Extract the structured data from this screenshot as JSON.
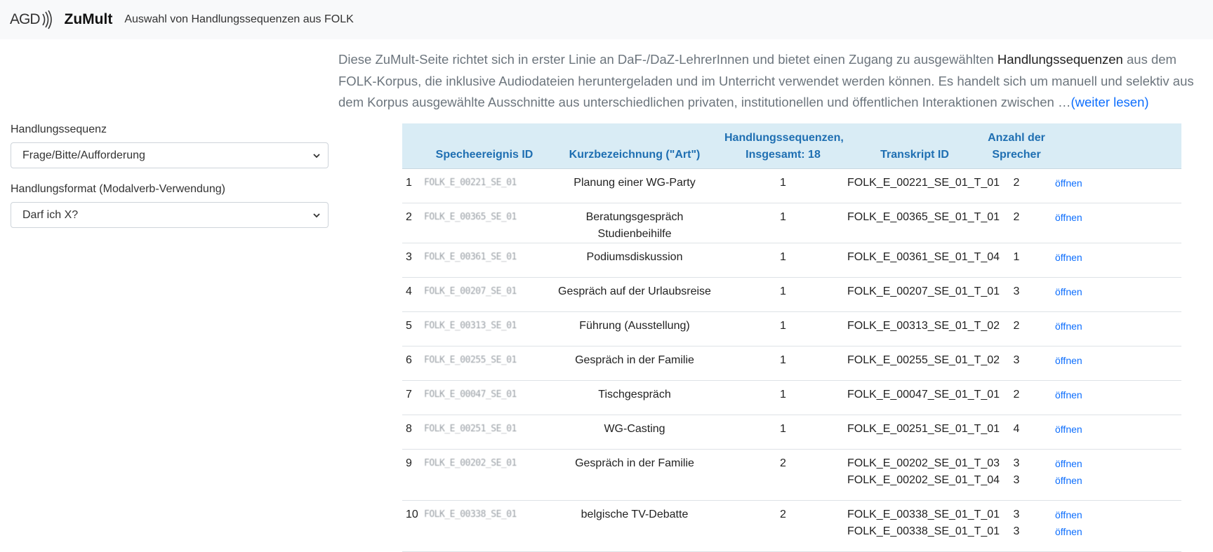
{
  "navbar": {
    "logo_text": "AGD",
    "brand": "ZuMult",
    "subtitle": "Auswahl von Handlungssequenzen aus FOLK"
  },
  "intro": {
    "part1": "Diese ZuMult-Seite richtet sich in erster Linie an DaF-/DaZ-LehrerInnen und bietet einen Zugang zu ausgewählten ",
    "highlight": "Handlungssequenzen",
    "part2": " aus dem FOLK-Korpus, die inklusive Audiodateien heruntergeladen und im Unterricht verwendet werden können. Es handelt sich um manuell und selektiv aus dem Korpus ausgewählte Ausschnitte aus unterschiedlichen privaten, institutionellen und öffentlichen Interaktionen zwischen …",
    "more_link": "(weiter lesen)"
  },
  "filters": {
    "sequence_label": "Handlungssequenz",
    "sequence_value": "Frage/Bitte/Aufforderung",
    "format_label": "Handlungsformat (Modalverb-Verwendung)",
    "format_value": "Darf ich X?"
  },
  "table": {
    "headers": {
      "event_id": "Specheereignis ID",
      "name": "Kurzbezeichnung (\"Art\")",
      "sequences_line1": "Handlungssequenzen,",
      "sequences_line2": "Insgesamt: 18",
      "transcript_id": "Transkript ID",
      "speakers_line1": "Anzahl der",
      "speakers_line2": "Sprecher"
    },
    "open_label": "öffnen",
    "rows": [
      {
        "num": "1",
        "event": "FOLK_E_00221_SE_01",
        "name": "Planung einer WG-Party",
        "count": "1",
        "t1": "FOLK_E_00221_SE_01_T_01",
        "s1": "2"
      },
      {
        "num": "2",
        "event": "FOLK_E_00365_SE_01",
        "name": "Beratungsgespräch Studienbeihilfe",
        "count": "1",
        "t1": "FOLK_E_00365_SE_01_T_01",
        "s1": "2"
      },
      {
        "num": "3",
        "event": "FOLK_E_00361_SE_01",
        "name": "Podiumsdiskussion",
        "count": "1",
        "t1": "FOLK_E_00361_SE_01_T_04",
        "s1": "1"
      },
      {
        "num": "4",
        "event": "FOLK_E_00207_SE_01",
        "name": "Gespräch auf der Urlaubsreise",
        "count": "1",
        "t1": "FOLK_E_00207_SE_01_T_01",
        "s1": "3"
      },
      {
        "num": "5",
        "event": "FOLK_E_00313_SE_01",
        "name": "Führung (Ausstellung)",
        "count": "1",
        "t1": "FOLK_E_00313_SE_01_T_02",
        "s1": "2"
      },
      {
        "num": "6",
        "event": "FOLK_E_00255_SE_01",
        "name": "Gespräch in der Familie",
        "count": "1",
        "t1": "FOLK_E_00255_SE_01_T_02",
        "s1": "3"
      },
      {
        "num": "7",
        "event": "FOLK_E_00047_SE_01",
        "name": "Tischgespräch",
        "count": "1",
        "t1": "FOLK_E_00047_SE_01_T_01",
        "s1": "2"
      },
      {
        "num": "8",
        "event": "FOLK_E_00251_SE_01",
        "name": "WG-Casting",
        "count": "1",
        "t1": "FOLK_E_00251_SE_01_T_01",
        "s1": "4"
      },
      {
        "num": "9",
        "event": "FOLK_E_00202_SE_01",
        "name": "Gespräch in der Familie",
        "count": "2",
        "t1": "FOLK_E_00202_SE_01_T_03",
        "s1": "3",
        "t2": "FOLK_E_00202_SE_01_T_04",
        "s2": "3"
      },
      {
        "num": "10",
        "event": "FOLK_E_00338_SE_01",
        "name": "belgische TV-Debatte",
        "count": "2",
        "t1": "FOLK_E_00338_SE_01_T_01",
        "s1": "3",
        "t2": "FOLK_E_00338_SE_01_T_01",
        "s2": "3"
      }
    ]
  }
}
